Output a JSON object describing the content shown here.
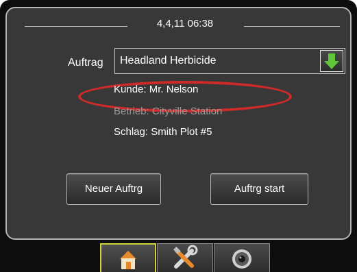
{
  "header": {
    "datetime": "4,4,11 06:38"
  },
  "job": {
    "label": "Auftrag",
    "selected": "Headland Herbicide"
  },
  "details": {
    "client": "Kunde: Mr. Nelson",
    "farm": "Betrieb: Cityville Station",
    "field": "Schlag: Smith Plot #5"
  },
  "actions": {
    "new_job": "Neuer Auftrg",
    "start_job": "Auftrg start"
  },
  "tabs": [
    {
      "icon": "home-icon"
    },
    {
      "icon": "tools-icon"
    },
    {
      "icon": "camera-icon"
    }
  ],
  "colors": {
    "panel_bg": "#383838",
    "highlight": "#cf2a2a",
    "dropdown_arrow": "#5fc43a",
    "active_tab_border": "#cfd23a",
    "dim_text": "#9a9a9a"
  }
}
